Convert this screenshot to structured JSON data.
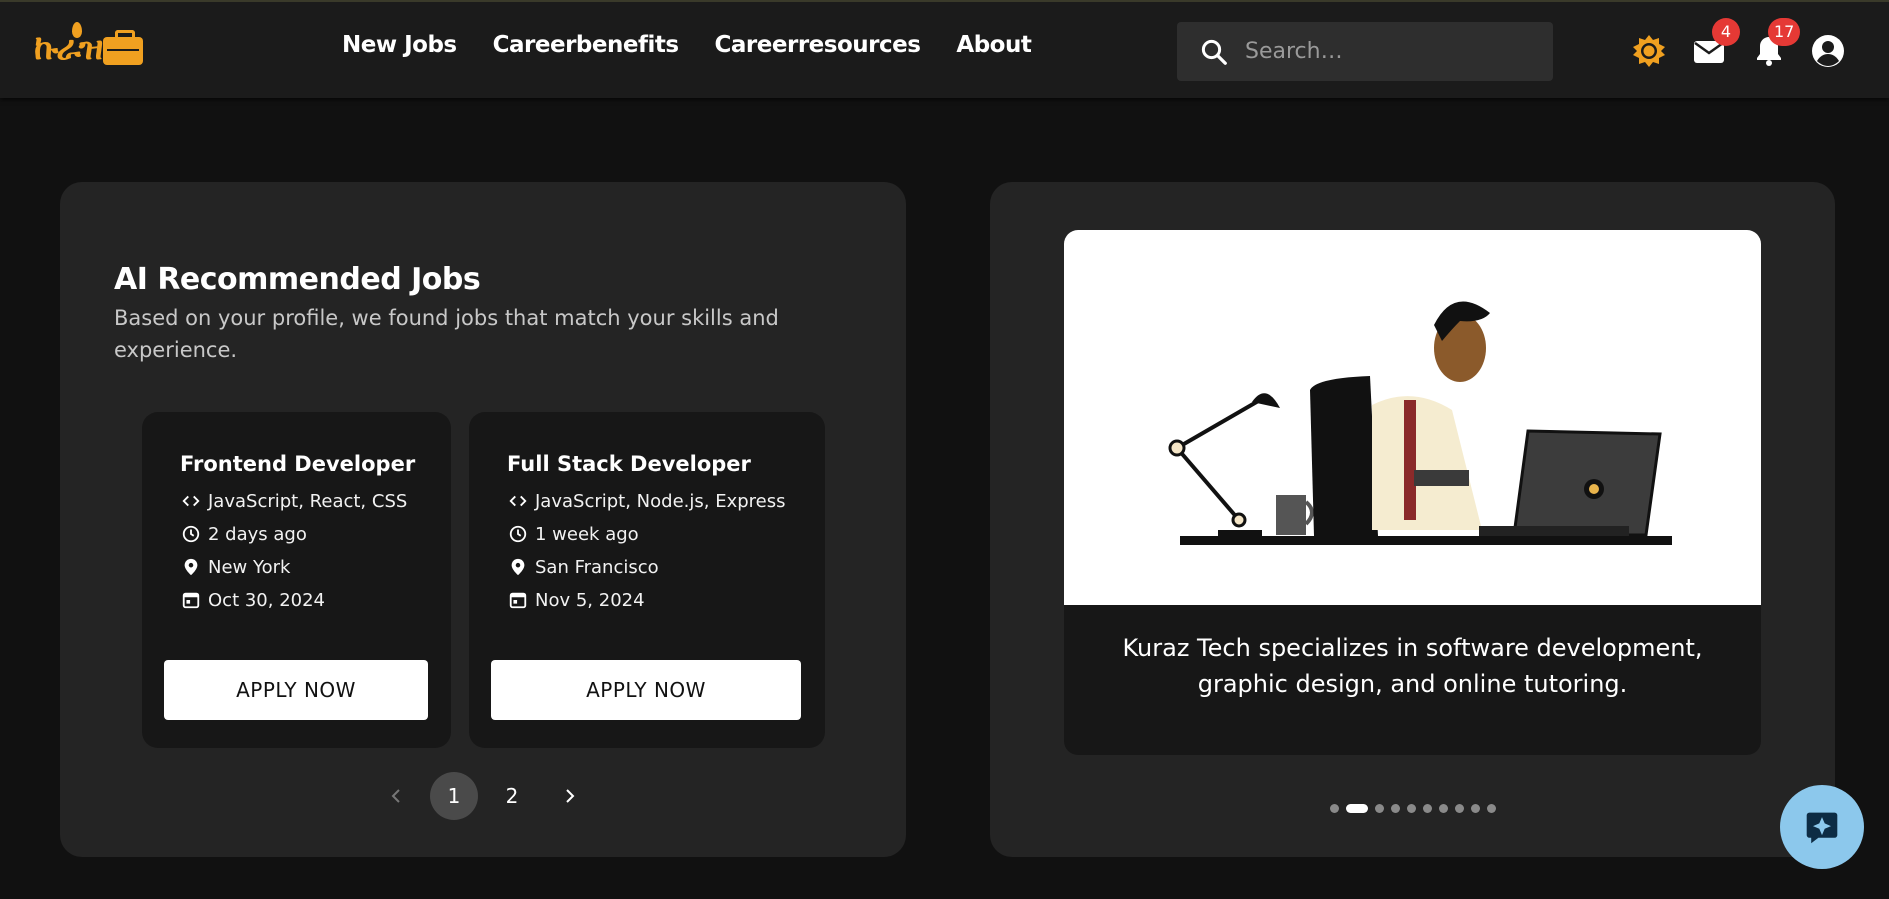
{
  "header": {
    "logo_text": "ኩራዝ",
    "nav": [
      "New Jobs",
      "Careerbenefits",
      "Careerresources",
      "About"
    ],
    "search_placeholder": "Search…",
    "mail_badge": "4",
    "notification_badge": "17",
    "icons": [
      "theme-sun-icon",
      "mail-icon",
      "bell-icon",
      "account-icon"
    ],
    "accent_color": "#f0a020",
    "badge_color": "#e53935"
  },
  "recommended": {
    "title": "AI Recommended Jobs",
    "subtitle": "Based on your profile, we found jobs that match your skills and experience.",
    "jobs": [
      {
        "title": "Frontend Developer",
        "skills": "JavaScript, React, CSS",
        "posted": "2 days ago",
        "location": "New York",
        "date": "Oct 30, 2024",
        "apply_label": "APPLY NOW"
      },
      {
        "title": "Full Stack Developer",
        "skills": "JavaScript, Node.js, Express",
        "posted": "1 week ago",
        "location": "San Francisco",
        "date": "Nov 5, 2024",
        "apply_label": "APPLY NOW"
      }
    ],
    "pagination": {
      "pages": [
        "1",
        "2"
      ],
      "current": "1"
    }
  },
  "carousel": {
    "caption": "Kuraz Tech specializes in software development, graphic design, and online tutoring.",
    "dot_count": 10,
    "active_dot": 1
  },
  "fab_icon": "ai-sparkle-chat-icon"
}
